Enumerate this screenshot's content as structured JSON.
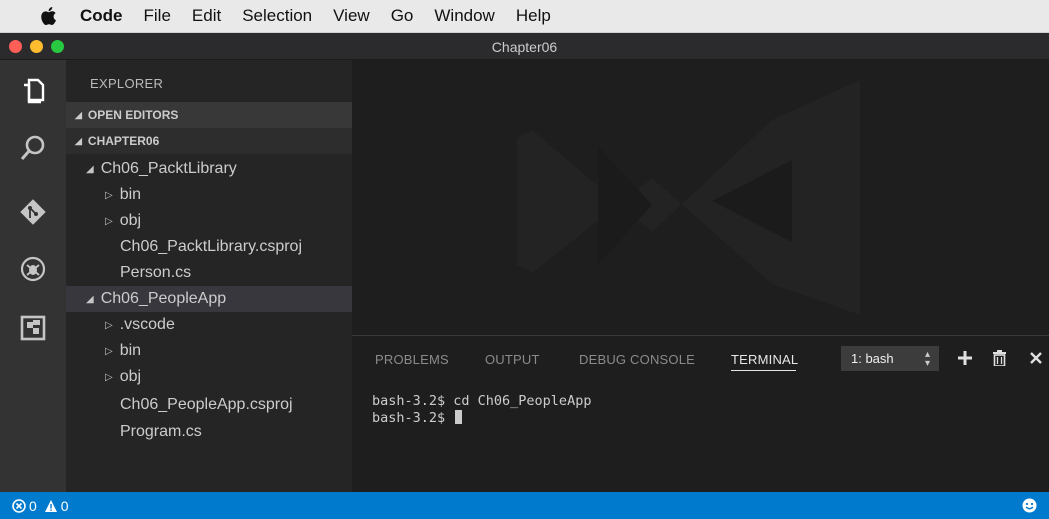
{
  "menubar": {
    "items": [
      {
        "label": "Code",
        "bold": true
      },
      {
        "label": "File"
      },
      {
        "label": "Edit"
      },
      {
        "label": "Selection"
      },
      {
        "label": "View"
      },
      {
        "label": "Go"
      },
      {
        "label": "Window"
      },
      {
        "label": "Help"
      }
    ]
  },
  "window": {
    "title": "Chapter06",
    "traffic_lights": [
      "#ff5f57",
      "#febc2e",
      "#28c840"
    ]
  },
  "activity_bar": {
    "icons": [
      "explorer-icon",
      "search-icon",
      "git-icon",
      "debug-icon",
      "extensions-icon"
    ]
  },
  "sidebar": {
    "title": "EXPLORER",
    "sections": {
      "open_editors": "OPEN EDITORS",
      "folder": "CHAPTER06"
    },
    "tree": [
      {
        "label": "Ch06_PacktLibrary",
        "type": "folder-open"
      },
      {
        "label": "bin",
        "type": "folder"
      },
      {
        "label": "obj",
        "type": "folder"
      },
      {
        "label": "Ch06_PacktLibrary.csproj",
        "type": "file"
      },
      {
        "label": "Person.cs",
        "type": "file"
      },
      {
        "label": "Ch06_PeopleApp",
        "type": "folder-open",
        "selected": true
      },
      {
        "label": ".vscode",
        "type": "folder"
      },
      {
        "label": "bin",
        "type": "folder"
      },
      {
        "label": "obj",
        "type": "folder"
      },
      {
        "label": "Ch06_PeopleApp.csproj",
        "type": "file"
      },
      {
        "label": "Program.cs",
        "type": "file"
      }
    ]
  },
  "panel": {
    "tabs": [
      "PROBLEMS",
      "OUTPUT",
      "DEBUG CONSOLE",
      "TERMINAL"
    ],
    "active_tab": "TERMINAL",
    "terminal_select": "1: bash",
    "terminal_lines": [
      "bash-3.2$ cd Ch06_PeopleApp",
      "bash-3.2$ "
    ]
  },
  "statusbar": {
    "errors": "0",
    "warnings": "0"
  },
  "colors": {
    "accent": "#007acc",
    "activity_bar": "#333333",
    "sidebar": "#252526",
    "editor": "#1e1e1e"
  }
}
